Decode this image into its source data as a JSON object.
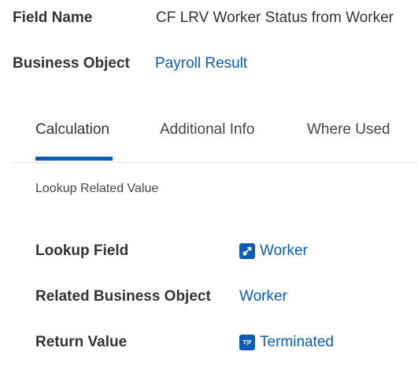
{
  "header": {
    "field_name_label": "Field Name",
    "field_name_value": "CF LRV Worker Status from Worker",
    "business_object_label": "Business Object",
    "business_object_value": "Payroll Result"
  },
  "tabs": [
    {
      "label": "Calculation",
      "active": true
    },
    {
      "label": "Additional Info",
      "active": false
    },
    {
      "label": "Where Used",
      "active": false
    }
  ],
  "calculation": {
    "type": "Lookup Related Value",
    "lookup_field_label": "Lookup Field",
    "lookup_field_value": "Worker",
    "lookup_field_icon": "instance-link-icon",
    "related_bo_label": "Related Business Object",
    "related_bo_value": "Worker",
    "return_value_label": "Return Value",
    "return_value_value": "Terminated",
    "return_value_icon": "boolean-field-icon",
    "return_value_icon_text": "T|F"
  },
  "colors": {
    "accent": "#0b5cb8",
    "text": "#333333",
    "divider": "#e3e3e3"
  }
}
